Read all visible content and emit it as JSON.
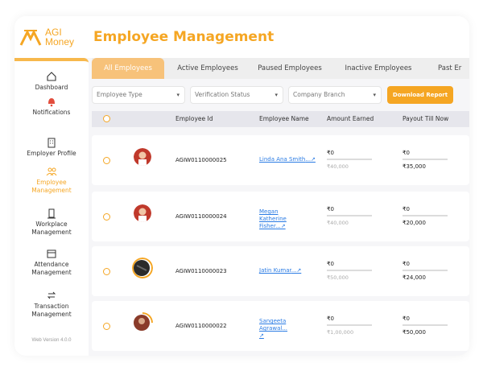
{
  "app": {
    "logo_line1": "AGI",
    "logo_line2": "Money",
    "page_title": "Employee Management"
  },
  "colors": {
    "accent": "#f5a623",
    "tab_active_bg": "#f7c27a",
    "link": "#2a7be4"
  },
  "sidebar": {
    "items": [
      {
        "label": "Dashboard",
        "icon": "home-icon"
      },
      {
        "label": "Notifications",
        "icon": "bell-icon"
      },
      {
        "label": "Employer Profile",
        "icon": "building-icon"
      },
      {
        "label": "Employee Management",
        "icon": "users-icon",
        "active": true
      },
      {
        "label": "Workplace Management",
        "icon": "workplace-icon"
      },
      {
        "label": "Attendance Management",
        "icon": "calendar-icon"
      },
      {
        "label": "Transaction Management",
        "icon": "swap-icon"
      }
    ],
    "version": "Web Version 4.0.0"
  },
  "tabs": [
    {
      "label": "All Employees",
      "active": true
    },
    {
      "label": "Active Employees"
    },
    {
      "label": "Paused Employees"
    },
    {
      "label": "Inactive Employees"
    },
    {
      "label": "Past Er"
    }
  ],
  "filters": {
    "employee_type": "Employee Type",
    "verification_status": "Verification Status",
    "company_branch": "Company Branch",
    "download_label": "Download Report"
  },
  "table": {
    "headers": {
      "employee_id": "Employee Id",
      "employee_name": "Employee Name",
      "amount_earned": "Amount Earned",
      "payout": "Payout Till Now"
    },
    "rows": [
      {
        "id": "AGIW0110000025",
        "name": "Linda Ana Smith",
        "amount": "₹0",
        "amount_sub": "₹40,000",
        "payout_top": "₹0",
        "payout": "₹35,000"
      },
      {
        "id": "AGIW0110000024",
        "name": "Megan Katherine Fisher",
        "amount": "₹0",
        "amount_sub": "₹40,000",
        "payout_top": "₹0",
        "payout": "₹20,000"
      },
      {
        "id": "AGIW0110000023",
        "name": "Jatin Kumar",
        "amount": "₹0",
        "amount_sub": "₹50,000",
        "payout_top": "₹0",
        "payout": "₹24,000"
      },
      {
        "id": "AGIW0110000022",
        "name": "Sangeeta Agrawal",
        "amount": "₹0",
        "amount_sub": "₹1,00,000",
        "payout_top": "₹0",
        "payout": "₹50,000"
      }
    ]
  }
}
